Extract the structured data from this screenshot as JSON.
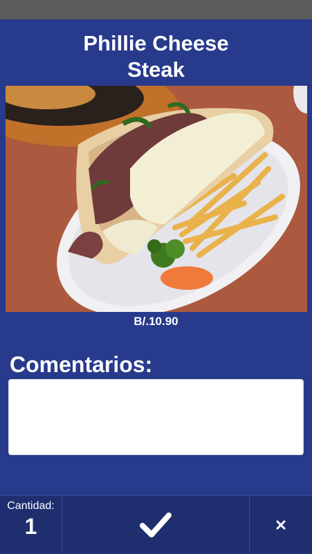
{
  "product": {
    "title_line1": "Phillie Cheese",
    "title_line2": "Steak",
    "price": "B/.10.90",
    "image_name": "phillie-cheese-steak-photo"
  },
  "comments": {
    "label": "Comentarios:",
    "value": ""
  },
  "footer": {
    "quantity_label": "Cantidad:",
    "quantity_value": "1",
    "confirm_icon": "checkmark-icon",
    "cancel_icon": "close-icon"
  }
}
